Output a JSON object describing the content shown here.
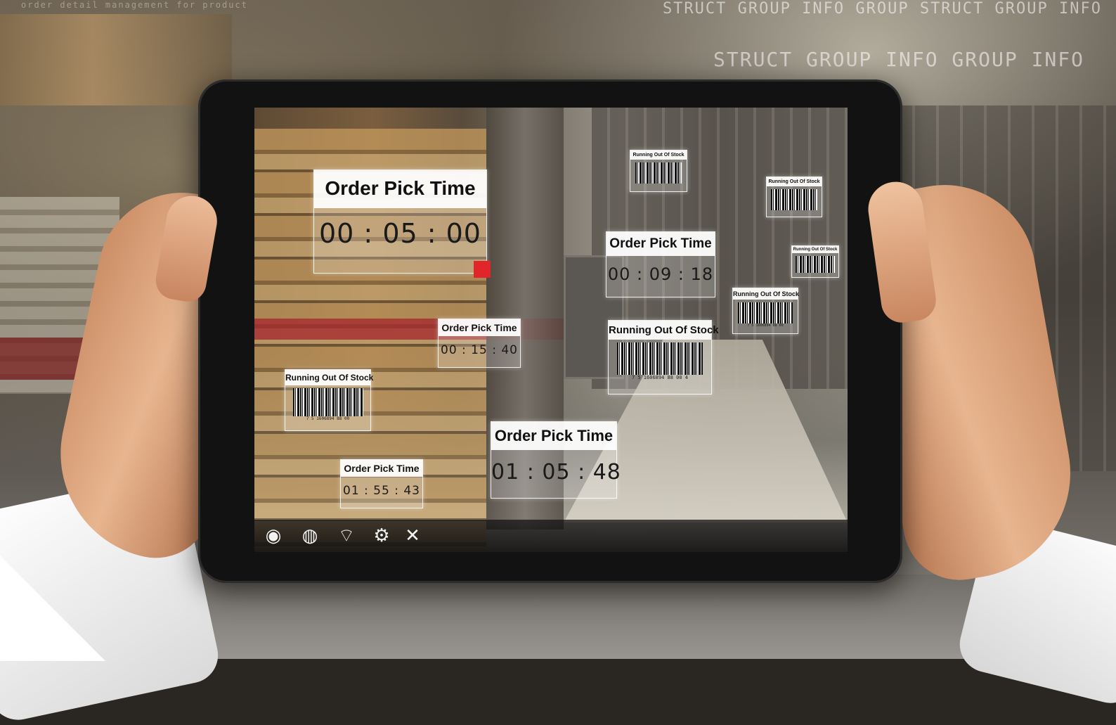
{
  "background": {
    "watermark_text_top": "STRUCT GROUP INFO GROUP STRUCT GROUP INFO",
    "watermark_text_mid": "STRUCT GROUP INFO GROUP INFO",
    "watermark_text_left": "order detail management for product"
  },
  "ar_overlays": {
    "order_pick_time_label": "Order Pick Time",
    "running_out_of_stock_label": "Running Out Of Stock",
    "timers": [
      {
        "label": "Order Pick Time",
        "value": "00 : 05 : 00"
      },
      {
        "label": "Order Pick Time",
        "value": "00 : 09 : 18"
      },
      {
        "label": "Order Pick Time",
        "value": "00 : 15 : 40"
      },
      {
        "label": "Order Pick Time",
        "value": "01 : 05 : 48"
      },
      {
        "label": "Order Pick Time",
        "value": "01 : 55 : 43"
      }
    ],
    "stock_alerts": [
      {
        "label": "Running Out Of Stock",
        "code": "7 5 1606894 88 00 4"
      },
      {
        "label": "Running Out Of Stock",
        "code": "7 5 1606894 88 00"
      },
      {
        "label": "Running Out Of Stock",
        "code": ""
      },
      {
        "label": "Running Out Of Stock",
        "code": ""
      },
      {
        "label": "Running Out Of Stock",
        "code": ""
      },
      {
        "label": "Running Out Of Stock",
        "code": "7 5 1606894 88 00"
      }
    ]
  },
  "toolbar": {
    "icons": [
      "eye-icon",
      "globe-icon",
      "wifi-icon",
      "gears-icon",
      "tools-icon"
    ],
    "glyphs": [
      "◉",
      "◍",
      "⌔",
      "⚙",
      "✕"
    ]
  },
  "colors": {
    "panel_border": "#ffffff",
    "tablet_body": "#121212",
    "marker_red": "#e0262b"
  }
}
